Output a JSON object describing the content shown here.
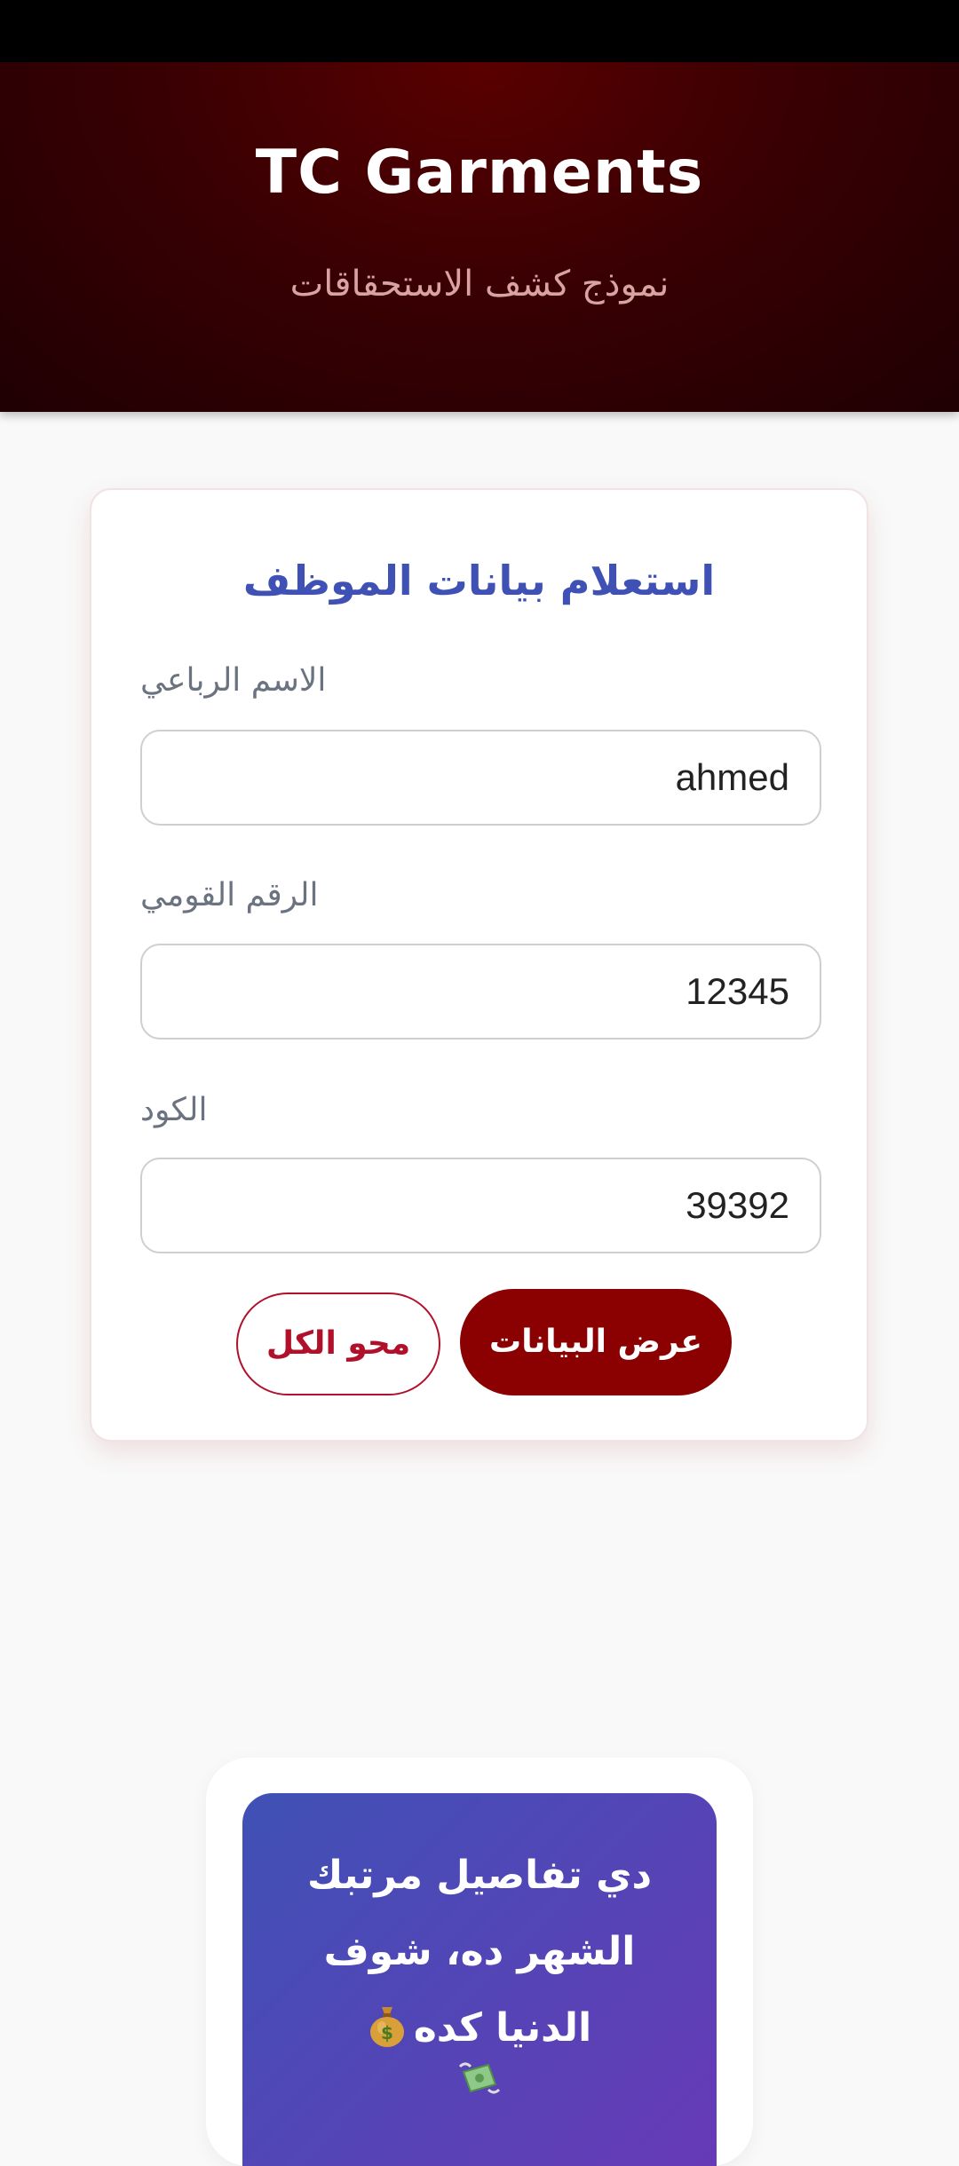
{
  "header": {
    "title": "TC Garments",
    "subtitle": "نموذج كشف الاستحقاقات"
  },
  "form": {
    "title": "استعلام بيانات الموظف",
    "fields": [
      {
        "label": "الاسم الرباعي",
        "value": "ahmed"
      },
      {
        "label": "الرقم القومي",
        "value": "12345"
      },
      {
        "label": "الكود",
        "value": "39392"
      }
    ],
    "submit_label": "عرض البيانات",
    "clear_label": "محو الكل"
  },
  "result": {
    "message": "دي تفاصيل مرتبك الشهر ده، شوف الدنيا كده",
    "icons": [
      "money-bag-icon",
      "money-with-wings-icon"
    ]
  },
  "colors": {
    "header_bg": "#3a0003",
    "form_title": "#3f51b5",
    "primary_button": "#8b0000",
    "secondary_button": "#b0102a",
    "banner_gradient_start": "#3f51b5",
    "banner_gradient_end": "#673ab7"
  }
}
